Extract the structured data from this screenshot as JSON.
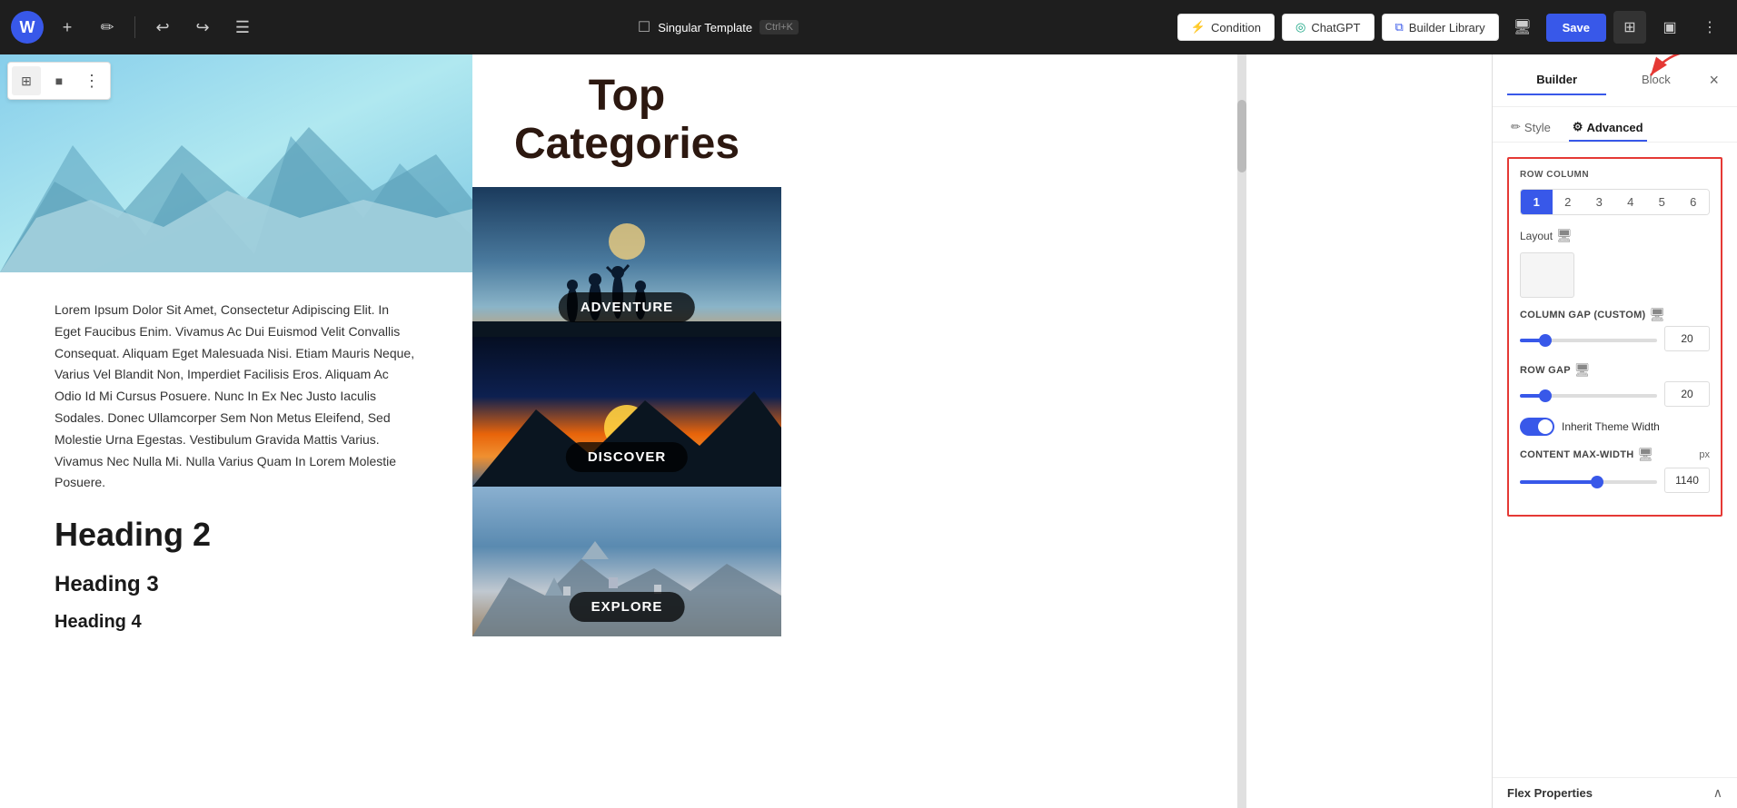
{
  "topbar": {
    "wp_logo": "W",
    "add_icon": "+",
    "pencil_icon": "✏",
    "undo_icon": "↩",
    "redo_icon": "↪",
    "menu_icon": "☰",
    "template_icon": "☐",
    "template_name": "Singular Template",
    "shortcut": "Ctrl+K",
    "condition_label": "Condition",
    "chatgpt_label": "ChatGPT",
    "library_label": "Builder Library",
    "monitor_icon": "🖥",
    "save_label": "Save",
    "grid_icon": "⊞",
    "panel_icon": "▣",
    "more_icon": "⋮"
  },
  "canvas": {
    "toolbar": {
      "layout_icon": "⊞",
      "block_icon": "■",
      "more_icon": "⋮"
    },
    "hero_title": "Top Categories",
    "body_text": "Lorem Ipsum Dolor Sit Amet, Consectetur Adipiscing Elit. In Eget Faucibus Enim. Vivamus Ac Dui Euismod Velit Convallis Consequat. Aliquam Eget Malesuada Nisi. Etiam Mauris Neque, Varius Vel Blandit Non, Imperdiet Facilisis Eros. Aliquam Ac Odio Id Mi Cursus Posuere. Nunc In Ex Nec Justo Iaculis Sodales. Donec Ullamcorper Sem Non Metus Eleifend, Sed Molestie Urna Egestas. Vestibulum Gravida Mattis Varius. Vivamus Nec Nulla Mi. Nulla Varius Quam In Lorem Molestie Posuere.",
    "heading2": "Heading 2",
    "heading3": "Heading 3",
    "heading4": "Heading 4",
    "categories": [
      {
        "label": "ADVENTURE",
        "bg_class": "cat-adventure"
      },
      {
        "label": "DISCOVER",
        "bg_class": "cat-discover"
      },
      {
        "label": "EXPLORE",
        "bg_class": "cat-explore"
      }
    ]
  },
  "panel": {
    "tab_builder": "Builder",
    "tab_block": "Block",
    "close_icon": "×",
    "subtab_style_icon": "✏",
    "subtab_style": "Style",
    "subtab_advanced_icon": "⚙",
    "subtab_advanced": "Advanced",
    "section_row_column": "ROW COLUMN",
    "col_options": [
      "1",
      "2",
      "3",
      "4",
      "5",
      "6"
    ],
    "layout_label": "Layout",
    "layout_device_icon": "🖥",
    "section_column_gap": "COLUMN GAP (CUSTOM)",
    "column_gap_device_icon": "🖥",
    "column_gap_value": "20",
    "section_row_gap": "ROW GAP",
    "row_gap_device_icon": "🖥",
    "row_gap_value": "20",
    "toggle_label": "Inherit Theme Width",
    "content_maxwidth_label": "CONTENT MAX-WIDTH",
    "content_maxwidth_device_icon": "🖥",
    "content_maxwidth_unit": "px",
    "content_maxwidth_value": "1140",
    "flex_properties_label": "Flex Properties",
    "chevron_up": "∧"
  }
}
